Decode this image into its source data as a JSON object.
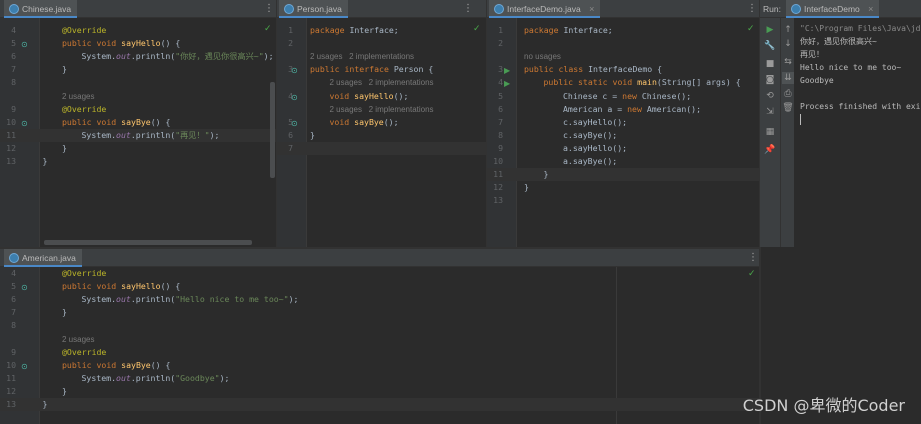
{
  "panes": {
    "chinese": {
      "tab": "Chinese.java",
      "lines": [
        {
          "n": "4",
          "parts": [
            [
              "ann",
              "@Override"
            ]
          ],
          "indent": 1
        },
        {
          "n": "5",
          "parts": [
            [
              "kw",
              "public void "
            ],
            [
              "fn",
              "sayHello"
            ],
            [
              "",
              "() {"
            ]
          ],
          "indent": 1,
          "icon": "impl"
        },
        {
          "n": "6",
          "parts": [
            [
              "",
              "System."
            ],
            [
              "fld",
              "out"
            ],
            [
              "",
              ".println("
            ],
            [
              "str",
              "\"你好，遇见你很高兴~\""
            ],
            [
              "",
              ");"
            ]
          ],
          "indent": 2
        },
        {
          "n": "7",
          "parts": [
            [
              "",
              "}"
            ]
          ],
          "indent": 1
        },
        {
          "n": "8",
          "parts": [],
          "indent": 0
        },
        {
          "n": "",
          "parts": [
            [
              "hint",
              "2 usages"
            ]
          ],
          "indent": 1
        },
        {
          "n": "9",
          "parts": [
            [
              "ann",
              "@Override"
            ]
          ],
          "indent": 1
        },
        {
          "n": "10",
          "parts": [
            [
              "kw",
              "public void "
            ],
            [
              "fn",
              "sayBye"
            ],
            [
              "",
              "() {"
            ]
          ],
          "indent": 1,
          "icon": "impl"
        },
        {
          "n": "11",
          "parts": [
            [
              "",
              "System."
            ],
            [
              "fld",
              "out"
            ],
            [
              "",
              ".println("
            ],
            [
              "str",
              "\"再见！\""
            ],
            [
              "",
              ");"
            ]
          ],
          "indent": 2,
          "hl": true
        },
        {
          "n": "12",
          "parts": [
            [
              "",
              "}"
            ]
          ],
          "indent": 1
        },
        {
          "n": "13",
          "parts": [
            [
              "",
              "}"
            ]
          ],
          "indent": 0
        }
      ]
    },
    "person": {
      "tab": "Person.java",
      "lines": [
        {
          "n": "1",
          "parts": [
            [
              "kw",
              "package "
            ],
            [
              "",
              "Interface;"
            ]
          ],
          "indent": 0
        },
        {
          "n": "2",
          "parts": [],
          "indent": 0
        },
        {
          "n": "",
          "parts": [
            [
              "hint",
              "2 usages   2 implementations"
            ]
          ],
          "indent": 0
        },
        {
          "n": "3",
          "parts": [
            [
              "kw",
              "public interface "
            ],
            [
              "",
              "Person {"
            ]
          ],
          "indent": 0,
          "icon": "impl"
        },
        {
          "n": "",
          "parts": [
            [
              "hint",
              "2 usages   2 implementations"
            ]
          ],
          "indent": 1
        },
        {
          "n": "4",
          "parts": [
            [
              "kw",
              "void "
            ],
            [
              "fn",
              "sayHello"
            ],
            [
              "",
              "();"
            ]
          ],
          "indent": 1,
          "icon": "impl"
        },
        {
          "n": "",
          "parts": [
            [
              "hint",
              "2 usages   2 implementations"
            ]
          ],
          "indent": 1
        },
        {
          "n": "5",
          "parts": [
            [
              "kw",
              "void "
            ],
            [
              "fn",
              "sayBye"
            ],
            [
              "",
              "();"
            ]
          ],
          "indent": 1,
          "icon": "impl"
        },
        {
          "n": "6",
          "parts": [
            [
              "",
              "}"
            ]
          ],
          "indent": 0
        },
        {
          "n": "7",
          "parts": [],
          "indent": 0,
          "hl": true
        }
      ]
    },
    "demo": {
      "tab": "InterfaceDemo.java",
      "lines": [
        {
          "n": "1",
          "parts": [
            [
              "kw",
              "package "
            ],
            [
              "",
              "Interface;"
            ]
          ],
          "indent": 0
        },
        {
          "n": "2",
          "parts": [],
          "indent": 0
        },
        {
          "n": "",
          "parts": [
            [
              "hint",
              "no usages"
            ]
          ],
          "indent": 0
        },
        {
          "n": "3",
          "parts": [
            [
              "kw",
              "public class "
            ],
            [
              "",
              "InterfaceDemo {"
            ]
          ],
          "indent": 0,
          "icon": "run"
        },
        {
          "n": "4",
          "parts": [
            [
              "kw",
              "public static void "
            ],
            [
              "fn",
              "main"
            ],
            [
              "",
              "(String[] args) {"
            ]
          ],
          "indent": 1,
          "icon": "run"
        },
        {
          "n": "5",
          "parts": [
            [
              "",
              "Chinese c = "
            ],
            [
              "kw",
              "new "
            ],
            [
              "",
              "Chinese();"
            ]
          ],
          "indent": 2
        },
        {
          "n": "6",
          "parts": [
            [
              "",
              "American a = "
            ],
            [
              "kw",
              "new "
            ],
            [
              "",
              "American();"
            ]
          ],
          "indent": 2
        },
        {
          "n": "7",
          "parts": [
            [
              "",
              "c.sayHello();"
            ]
          ],
          "indent": 2
        },
        {
          "n": "8",
          "parts": [
            [
              "",
              "c.sayBye();"
            ]
          ],
          "indent": 2
        },
        {
          "n": "9",
          "parts": [
            [
              "",
              "a.sayHello();"
            ]
          ],
          "indent": 2
        },
        {
          "n": "10",
          "parts": [
            [
              "",
              "a.sayBye();"
            ]
          ],
          "indent": 2
        },
        {
          "n": "11",
          "parts": [
            [
              "",
              "}"
            ]
          ],
          "indent": 1,
          "hl": true
        },
        {
          "n": "12",
          "parts": [
            [
              "",
              "}"
            ]
          ],
          "indent": 0
        },
        {
          "n": "13",
          "parts": [],
          "indent": 0
        }
      ]
    },
    "american": {
      "tab": "American.java",
      "lines": [
        {
          "n": "4",
          "parts": [
            [
              "ann",
              "@Override"
            ]
          ],
          "indent": 1
        },
        {
          "n": "5",
          "parts": [
            [
              "kw",
              "public void "
            ],
            [
              "fn",
              "sayHello"
            ],
            [
              "",
              "() {"
            ]
          ],
          "indent": 1,
          "icon": "impl"
        },
        {
          "n": "6",
          "parts": [
            [
              "",
              "System."
            ],
            [
              "fld",
              "out"
            ],
            [
              "",
              ".println("
            ],
            [
              "str",
              "\"Hello nice to me too~\""
            ],
            [
              "",
              ");"
            ]
          ],
          "indent": 2
        },
        {
          "n": "7",
          "parts": [
            [
              "",
              "}"
            ]
          ],
          "indent": 1
        },
        {
          "n": "8",
          "parts": [],
          "indent": 0
        },
        {
          "n": "",
          "parts": [
            [
              "hint",
              "2 usages"
            ]
          ],
          "indent": 1
        },
        {
          "n": "9",
          "parts": [
            [
              "ann",
              "@Override"
            ]
          ],
          "indent": 1
        },
        {
          "n": "10",
          "parts": [
            [
              "kw",
              "public void "
            ],
            [
              "fn",
              "sayBye"
            ],
            [
              "",
              "() {"
            ]
          ],
          "indent": 1,
          "icon": "impl"
        },
        {
          "n": "11",
          "parts": [
            [
              "",
              "System."
            ],
            [
              "fld",
              "out"
            ],
            [
              "",
              ".println("
            ],
            [
              "str",
              "\"Goodbye\""
            ],
            [
              "",
              ");"
            ]
          ],
          "indent": 2
        },
        {
          "n": "12",
          "parts": [
            [
              "",
              "}"
            ]
          ],
          "indent": 1
        },
        {
          "n": "13",
          "parts": [
            [
              "",
              "}"
            ]
          ],
          "indent": 0,
          "hl": true
        }
      ]
    }
  },
  "run": {
    "label": "Run:",
    "tab": "InterfaceDemo",
    "output": [
      "\"C:\\Program Files\\Java\\jd",
      "你好，遇见你很高兴~",
      "再见！",
      "Hello nice to me too~",
      "Goodbye",
      "",
      "Process finished with exi"
    ]
  },
  "watermark": "CSDN @卑微的Coder",
  "icons": {
    "tab_file": "java-file-icon",
    "gutter_run": "run-arrow-icon",
    "gutter_impl": "implementation-icon",
    "check": "check-icon"
  }
}
